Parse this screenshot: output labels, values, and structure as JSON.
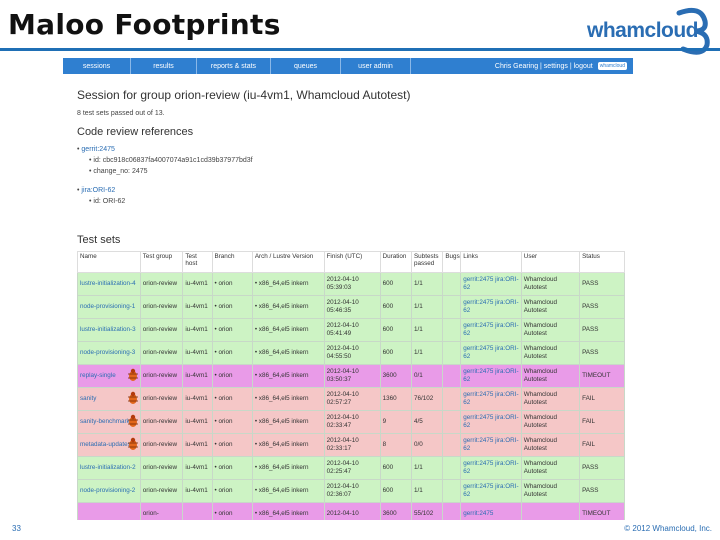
{
  "slide": {
    "title": "Maloo Footprints",
    "logo_text": "whamcloud",
    "page_number": "33",
    "copyright": "© 2012 Whamcloud, Inc."
  },
  "nav": {
    "items": [
      "sessions",
      "results",
      "reports & stats",
      "queues",
      "user admin"
    ],
    "user_links": "Chris Gearing | settings | logout",
    "brand_mini": "whamcloud"
  },
  "session": {
    "title": "Session for group orion-review (iu-4vm1, Whamcloud Autotest)",
    "summary": "8 test sets passed out of 13."
  },
  "code_review": {
    "heading": "Code review references",
    "gerrit_label": "gerrit:2475",
    "gerrit_id": "id: cbc918c06837fa4007074a91c1cd39b37977bd3f",
    "gerrit_change": "change_no: 2475",
    "jira_label": "jira:ORI-62",
    "jira_id": "id: ORI-62"
  },
  "test_sets": {
    "heading": "Test sets",
    "columns": [
      "Name",
      "Test group",
      "Test host",
      "Branch",
      "Arch / Lustre Version",
      "Finish (UTC)",
      "Duration",
      "Subtests passed",
      "Bugs",
      "Links",
      "User",
      "Status"
    ],
    "rows": [
      {
        "name": "lustre-initialization-4",
        "group": "orion-review",
        "host": "iu-4vm1",
        "branch": "• orion",
        "arch": "• x86_64,el5 inkern",
        "finish": "2012-04-10 05:39:03",
        "duration": "600",
        "passed": "1/1",
        "bugs": "",
        "links": "gerrit:2475 jira:ORI-62",
        "user": "Whamcloud Autotest",
        "status": "PASS",
        "kind": "pass",
        "bug_icon": false
      },
      {
        "name": "node-provisioning-1",
        "group": "orion-review",
        "host": "iu-4vm1",
        "branch": "• orion",
        "arch": "• x86_64,el5 inkern",
        "finish": "2012-04-10 05:46:35",
        "duration": "600",
        "passed": "1/1",
        "bugs": "",
        "links": "gerrit:2475 jira:ORI-62",
        "user": "Whamcloud Autotest",
        "status": "PASS",
        "kind": "pass",
        "bug_icon": false
      },
      {
        "name": "lustre-initialization-3",
        "group": "orion-review",
        "host": "iu-4vm1",
        "branch": "• orion",
        "arch": "• x86_64,el5 inkern",
        "finish": "2012-04-10 05:41:49",
        "duration": "600",
        "passed": "1/1",
        "bugs": "",
        "links": "gerrit:2475 jira:ORI-62",
        "user": "Whamcloud Autotest",
        "status": "PASS",
        "kind": "pass",
        "bug_icon": false
      },
      {
        "name": "node-provisioning-3",
        "group": "orion-review",
        "host": "iu-4vm1",
        "branch": "• orion",
        "arch": "• x86_64,el5 inkern",
        "finish": "2012-04-10 04:55:50",
        "duration": "600",
        "passed": "1/1",
        "bugs": "",
        "links": "gerrit:2475 jira:ORI-62",
        "user": "Whamcloud Autotest",
        "status": "PASS",
        "kind": "pass",
        "bug_icon": false
      },
      {
        "name": "replay-single",
        "group": "orion-review",
        "host": "iu-4vm1",
        "branch": "• orion",
        "arch": "• x86_64,el5 inkern",
        "finish": "2012-04-10 03:50:37",
        "duration": "3600",
        "passed": "0/1",
        "bugs": "",
        "links": "gerrit:2475 jira:ORI-62",
        "user": "Whamcloud Autotest",
        "status": "TIMEOUT",
        "kind": "timeout",
        "bug_icon": true
      },
      {
        "name": "sanity",
        "group": "orion-review",
        "host": "iu-4vm1",
        "branch": "• orion",
        "arch": "• x86_64,el5 inkern",
        "finish": "2012-04-10 02:57:27",
        "duration": "1360",
        "passed": "76/102",
        "bugs": "",
        "links": "gerrit:2475 jira:ORI-62",
        "user": "Whamcloud Autotest",
        "status": "FAIL",
        "kind": "fail",
        "bug_icon": true
      },
      {
        "name": "sanity-benchmark",
        "group": "orion-review",
        "host": "iu-4vm1",
        "branch": "• orion",
        "arch": "• x86_64,el5 inkern",
        "finish": "2012-04-10 02:33:47",
        "duration": "9",
        "passed": "4/5",
        "bugs": "",
        "links": "gerrit:2475 jira:ORI-62",
        "user": "Whamcloud Autotest",
        "status": "FAIL",
        "kind": "fail",
        "bug_icon": true
      },
      {
        "name": "metadata-updates",
        "group": "orion-review",
        "host": "iu-4vm1",
        "branch": "• orion",
        "arch": "• x86_64,el5 inkern",
        "finish": "2012-04-10 02:33:17",
        "duration": "8",
        "passed": "0/0",
        "bugs": "",
        "links": "gerrit:2475 jira:ORI-62",
        "user": "Whamcloud Autotest",
        "status": "FAIL",
        "kind": "fail",
        "bug_icon": true
      },
      {
        "name": "lustre-initialization-2",
        "group": "orion-review",
        "host": "iu-4vm1",
        "branch": "• orion",
        "arch": "• x86_64,el5 inkern",
        "finish": "2012-04-10 02:25:47",
        "duration": "600",
        "passed": "1/1",
        "bugs": "",
        "links": "gerrit:2475 jira:ORI-62",
        "user": "Whamcloud Autotest",
        "status": "PASS",
        "kind": "pass",
        "bug_icon": false
      },
      {
        "name": "node-provisioning-2",
        "group": "orion-review",
        "host": "iu-4vm1",
        "branch": "• orion",
        "arch": "• x86_64,el5 inkern",
        "finish": "2012-04-10 02:36:07",
        "duration": "600",
        "passed": "1/1",
        "bugs": "",
        "links": "gerrit:2475 jira:ORI-62",
        "user": "Whamcloud Autotest",
        "status": "PASS",
        "kind": "pass",
        "bug_icon": false
      },
      {
        "name": "",
        "group": "orion-",
        "host": "",
        "branch": "• orion",
        "arch": "• x86_64,el5 inkern",
        "finish": "2012-04-10",
        "duration": "3600",
        "passed": "55/102",
        "bugs": "",
        "links": "gerrit:2475",
        "user": "",
        "status": "TIMEOUT",
        "kind": "timeout",
        "bug_icon": false
      }
    ]
  }
}
